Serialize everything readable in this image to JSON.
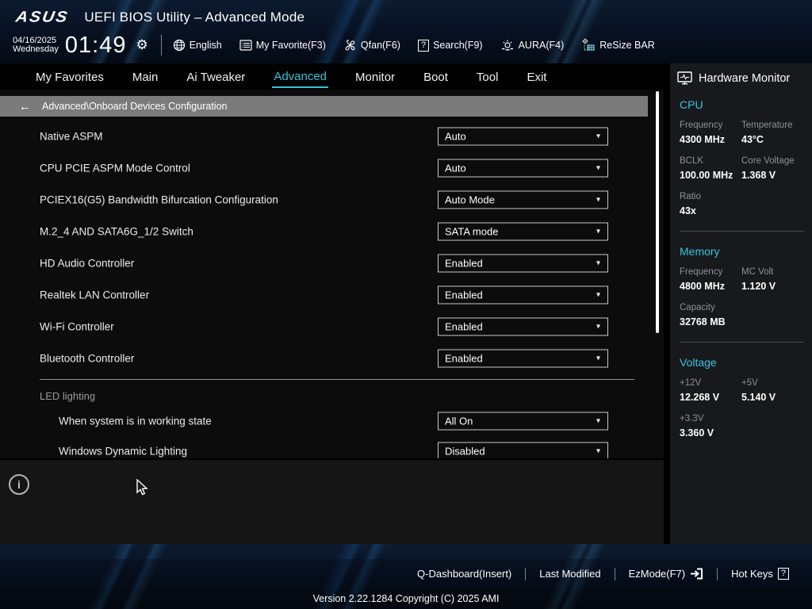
{
  "icons": {
    "gear": "⚙",
    "back_arrow": "←",
    "dropdown_arrow": "▾",
    "question": "?",
    "info": "i"
  },
  "colors": {
    "accent": "#35c3d7",
    "breadcrumb_bg": "#7b7b7b",
    "sidebar_bg": "#17191d"
  },
  "header": {
    "logo": "ASUS",
    "title": "UEFI BIOS Utility – Advanced Mode",
    "date": "04/16/2025",
    "weekday": "Wednesday",
    "time": "01:49",
    "toolbar": [
      {
        "icon": "globe-icon",
        "label": "English"
      },
      {
        "icon": "my-favorite-icon",
        "label": "My Favorite(F3)"
      },
      {
        "icon": "qfan-icon",
        "label": "Qfan(F6)"
      },
      {
        "icon": "search-icon",
        "label": "Search(F9)"
      },
      {
        "icon": "aura-icon",
        "label": "AURA(F4)"
      },
      {
        "icon": "resize-bar-icon",
        "label": "ReSize BAR"
      }
    ]
  },
  "nav": {
    "tabs": [
      {
        "label": "My Favorites",
        "active": false
      },
      {
        "label": "Main",
        "active": false
      },
      {
        "label": "Ai Tweaker",
        "active": false
      },
      {
        "label": "Advanced",
        "active": true
      },
      {
        "label": "Monitor",
        "active": false
      },
      {
        "label": "Boot",
        "active": false
      },
      {
        "label": "Tool",
        "active": false
      },
      {
        "label": "Exit",
        "active": false
      }
    ]
  },
  "breadcrumb": {
    "path": "Advanced\\Onboard Devices Configuration"
  },
  "settings": {
    "items": [
      {
        "label": "Native ASPM",
        "value": "Auto"
      },
      {
        "label": "CPU PCIE ASPM Mode Control",
        "value": "Auto"
      },
      {
        "label": "PCIEX16(G5) Bandwidth Bifurcation Configuration",
        "value": "Auto Mode"
      },
      {
        "label": "M.2_4 AND SATA6G_1/2 Switch",
        "value": "SATA mode"
      },
      {
        "label": "HD Audio Controller",
        "value": "Enabled"
      },
      {
        "label": "Realtek LAN Controller",
        "value": "Enabled"
      },
      {
        "label": "Wi-Fi Controller",
        "value": "Enabled"
      },
      {
        "label": "Bluetooth Controller",
        "value": "Enabled"
      }
    ],
    "section_label": "LED lighting",
    "sub_items": [
      {
        "label": "When system is in working state",
        "value": "All On"
      },
      {
        "label": "Windows Dynamic Lighting",
        "value": "Disabled"
      }
    ]
  },
  "hardware_monitor": {
    "title": "Hardware Monitor",
    "sections": [
      {
        "title": "CPU",
        "cells": [
          {
            "label": "Frequency",
            "value": "4300 MHz"
          },
          {
            "label": "Temperature",
            "value": "43°C"
          },
          {
            "label": "BCLK",
            "value": "100.00 MHz"
          },
          {
            "label": "Core Voltage",
            "value": "1.368 V"
          },
          {
            "label": "Ratio",
            "value": "43x"
          }
        ]
      },
      {
        "title": "Memory",
        "cells": [
          {
            "label": "Frequency",
            "value": "4800 MHz"
          },
          {
            "label": "MC Volt",
            "value": "1.120 V"
          },
          {
            "label": "Capacity",
            "value": "32768 MB"
          }
        ]
      },
      {
        "title": "Voltage",
        "cells": [
          {
            "label": "+12V",
            "value": "12.268 V"
          },
          {
            "label": "+5V",
            "value": "5.140 V"
          },
          {
            "label": "+3.3V",
            "value": "3.360 V"
          }
        ]
      }
    ]
  },
  "footer": {
    "items": [
      {
        "label": "Q-Dashboard(Insert)"
      },
      {
        "label": "Last Modified"
      },
      {
        "label": "EzMode(F7)"
      },
      {
        "label": "Hot Keys"
      }
    ],
    "version": "Version 2.22.1284 Copyright (C) 2025 AMI"
  }
}
